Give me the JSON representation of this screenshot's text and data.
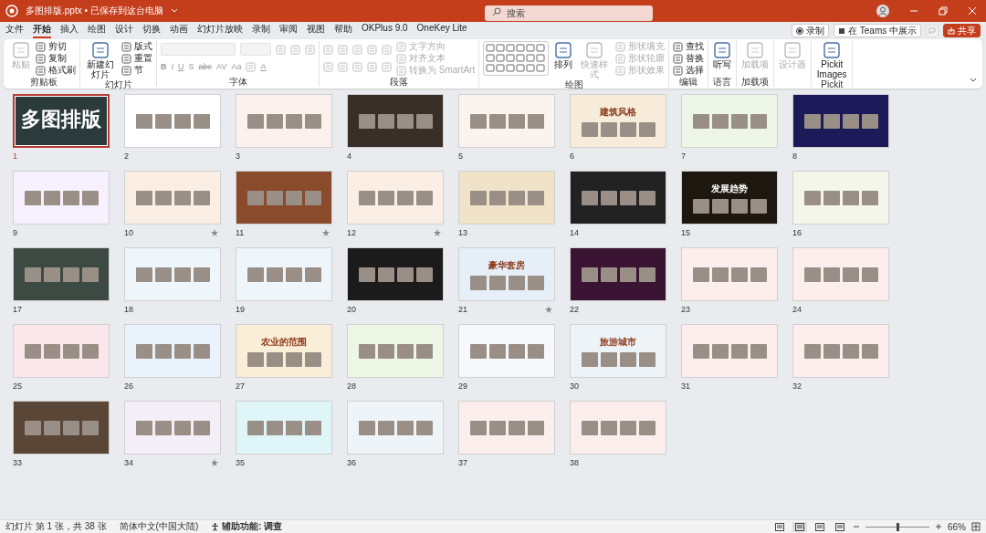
{
  "title_bar": {
    "document_title": "多图排版.pptx • 已保存到这台电脑",
    "search_placeholder": "搜索"
  },
  "menu_tabs": [
    {
      "label": "文件",
      "selected": false
    },
    {
      "label": "开始",
      "selected": true
    },
    {
      "label": "插入",
      "selected": false
    },
    {
      "label": "绘图",
      "selected": false
    },
    {
      "label": "设计",
      "selected": false
    },
    {
      "label": "切换",
      "selected": false
    },
    {
      "label": "动画",
      "selected": false
    },
    {
      "label": "幻灯片放映",
      "selected": false
    },
    {
      "label": "录制",
      "selected": false
    },
    {
      "label": "审阅",
      "selected": false
    },
    {
      "label": "视图",
      "selected": false
    },
    {
      "label": "帮助",
      "selected": false
    },
    {
      "label": "OKPlus 9.0",
      "selected": false
    },
    {
      "label": "OneKey Lite",
      "selected": false
    }
  ],
  "actions": {
    "record": "录制",
    "teams": "在 Teams 中展示",
    "share": "共享"
  },
  "ribbon_groups": [
    {
      "label": "剪贴板",
      "columns": [
        [
          {
            "kind": "large",
            "label": "粘贴",
            "disabled": true
          }
        ],
        [
          {
            "kind": "small",
            "label": "剪切",
            "disabled": false
          },
          {
            "kind": "small",
            "label": "复制",
            "disabled": false
          },
          {
            "kind": "small",
            "label": "格式刷",
            "disabled": false
          }
        ]
      ]
    },
    {
      "label": "幻灯片",
      "columns": [
        [
          {
            "kind": "large",
            "label": "新建幻灯片",
            "disabled": false
          }
        ],
        [
          {
            "kind": "small",
            "label": "版式",
            "disabled": false
          },
          {
            "kind": "small",
            "label": "重置",
            "disabled": false
          },
          {
            "kind": "small",
            "label": "节",
            "disabled": false
          }
        ]
      ]
    },
    {
      "label": "字体",
      "columns": [
        [
          {
            "kind": "row",
            "items": [
              {
                "kind": "combo",
                "disabled": true
              },
              {
                "kind": "combo_narrow",
                "disabled": true
              },
              {
                "kind": "icon",
                "disabled": true
              },
              {
                "kind": "icon",
                "disabled": true
              },
              {
                "kind": "icon",
                "disabled": true
              }
            ]
          },
          {
            "kind": "row",
            "items": [
              {
                "kind": "glyph",
                "label": "B",
                "disabled": true
              },
              {
                "kind": "glyph",
                "label": "I",
                "disabled": true
              },
              {
                "kind": "glyph",
                "label": "U",
                "disabled": true
              },
              {
                "kind": "glyph",
                "label": "S",
                "disabled": true
              },
              {
                "kind": "glyph",
                "label": "abc",
                "disabled": true
              },
              {
                "kind": "glyph",
                "label": "AV",
                "disabled": true
              },
              {
                "kind": "glyph",
                "label": "Aa",
                "disabled": true
              },
              {
                "kind": "icon",
                "disabled": true
              },
              {
                "kind": "glyph",
                "label": "A",
                "disabled": true
              }
            ]
          }
        ]
      ]
    },
    {
      "label": "段落",
      "columns": [
        [
          {
            "kind": "row",
            "items": [
              {
                "kind": "icon",
                "disabled": true
              },
              {
                "kind": "icon",
                "disabled": true
              },
              {
                "kind": "icon",
                "disabled": true
              },
              {
                "kind": "icon",
                "disabled": true
              },
              {
                "kind": "icon",
                "disabled": true
              }
            ]
          },
          {
            "kind": "row",
            "items": [
              {
                "kind": "icon",
                "disabled": true
              },
              {
                "kind": "icon",
                "disabled": true
              },
              {
                "kind": "icon",
                "disabled": true
              },
              {
                "kind": "icon",
                "disabled": true
              },
              {
                "kind": "icon",
                "disabled": true
              }
            ]
          }
        ],
        [
          {
            "kind": "small",
            "label": "文字方向",
            "disabled": true
          },
          {
            "kind": "small",
            "label": "对齐文本",
            "disabled": true
          },
          {
            "kind": "small",
            "label": "转换为 SmartArt",
            "disabled": true
          }
        ]
      ]
    },
    {
      "label": "绘图",
      "columns": [
        [
          {
            "kind": "gallery"
          }
        ],
        [
          {
            "kind": "large",
            "label": "排列",
            "disabled": false
          }
        ],
        [
          {
            "kind": "large",
            "label": "快速样式",
            "disabled": true
          }
        ],
        [
          {
            "kind": "small",
            "label": "形状填充",
            "disabled": true
          },
          {
            "kind": "small",
            "label": "形状轮廓",
            "disabled": true
          },
          {
            "kind": "small",
            "label": "形状效果",
            "disabled": true
          }
        ]
      ]
    },
    {
      "label": "编辑",
      "columns": [
        [
          {
            "kind": "small",
            "label": "查找",
            "disabled": false
          },
          {
            "kind": "small",
            "label": "替换",
            "disabled": false
          },
          {
            "kind": "small",
            "label": "选择",
            "disabled": false
          }
        ]
      ]
    },
    {
      "label": "语言",
      "columns": [
        [
          {
            "kind": "large",
            "label": "听写",
            "disabled": false
          }
        ]
      ]
    },
    {
      "label": "加载项",
      "columns": [
        [
          {
            "kind": "large",
            "label": "加载项",
            "disabled": true
          }
        ]
      ]
    },
    {
      "columns": [
        [
          {
            "kind": "large",
            "label": "设计器",
            "disabled": true
          }
        ]
      ]
    },
    {
      "label": "Pickit",
      "columns": [
        [
          {
            "kind": "large",
            "label": "Pickit Images",
            "disabled": false
          }
        ]
      ]
    }
  ],
  "slides": [
    {
      "number": "1",
      "title": "多图排版",
      "color": "#2b3a3a",
      "selected": true,
      "transition": false
    },
    {
      "number": "2",
      "color": "#ffffff",
      "selected": false,
      "transition": false
    },
    {
      "number": "3",
      "color": "#fdf1ee",
      "selected": false,
      "transition": false
    },
    {
      "number": "4",
      "color": "#3a2e28",
      "selected": false,
      "transition": false
    },
    {
      "number": "5",
      "color": "#fbf3ee",
      "selected": false,
      "transition": false
    },
    {
      "number": "6",
      "title": "建筑风格",
      "color": "#f7ecd9",
      "selected": false,
      "transition": false
    },
    {
      "number": "7",
      "color": "#eef6e8",
      "selected": false,
      "transition": false
    },
    {
      "number": "8",
      "color": "#1d1a5a",
      "selected": false,
      "transition": false
    },
    {
      "number": "9",
      "color": "#f6f0ff",
      "selected": false,
      "transition": false
    },
    {
      "number": "10",
      "color": "#fbeee4",
      "selected": false,
      "transition": true
    },
    {
      "number": "11",
      "color": "#8a4a2c",
      "selected": false,
      "transition": true
    },
    {
      "number": "12",
      "color": "#fbeee4",
      "selected": false,
      "transition": true
    },
    {
      "number": "13",
      "color": "#f1e3c8",
      "selected": false,
      "transition": false
    },
    {
      "number": "14",
      "color": "#222222",
      "selected": false,
      "transition": false
    },
    {
      "number": "15",
      "title": "发展趋势",
      "color": "#1e1710",
      "selected": false,
      "transition": false
    },
    {
      "number": "16",
      "color": "#f4f6ea",
      "selected": false,
      "transition": false
    },
    {
      "number": "17",
      "color": "#3d4a44",
      "selected": false,
      "transition": false
    },
    {
      "number": "18",
      "color": "#eef6fc",
      "selected": false,
      "transition": false
    },
    {
      "number": "19",
      "color": "#eef6fc",
      "selected": false,
      "transition": false
    },
    {
      "number": "20",
      "color": "#1b1b1b",
      "selected": false,
      "transition": false
    },
    {
      "number": "21",
      "title": "豪华套房",
      "color": "#e6eef8",
      "selected": false,
      "transition": true
    },
    {
      "number": "22",
      "color": "#3a1432",
      "selected": false,
      "transition": false
    },
    {
      "number": "23",
      "color": "#fdeeee",
      "selected": false,
      "transition": false
    },
    {
      "number": "24",
      "color": "#fdeeee",
      "selected": false,
      "transition": false
    },
    {
      "number": "25",
      "color": "#fbe6ec",
      "selected": false,
      "transition": false
    },
    {
      "number": "26",
      "color": "#eaf2fb",
      "selected": false,
      "transition": false
    },
    {
      "number": "27",
      "title": "农业的范围",
      "color": "#fbeed8",
      "selected": false,
      "transition": false
    },
    {
      "number": "28",
      "color": "#eef6e6",
      "selected": false,
      "transition": false
    },
    {
      "number": "29",
      "color": "#f6f8fb",
      "selected": false,
      "transition": false
    },
    {
      "number": "30",
      "title": "旅游城市",
      "color": "#eef3f8",
      "selected": false,
      "transition": false
    },
    {
      "number": "31",
      "color": "#fdeeee",
      "selected": false,
      "transition": false
    },
    {
      "number": "32",
      "color": "#fdeeee",
      "selected": false,
      "transition": false
    },
    {
      "number": "33",
      "color": "#5a4636",
      "selected": false,
      "transition": false
    },
    {
      "number": "34",
      "color": "#f3eef8",
      "selected": false,
      "transition": true
    },
    {
      "number": "35",
      "color": "#dff5f8",
      "selected": false,
      "transition": false
    },
    {
      "number": "36",
      "color": "#eef4f8",
      "selected": false,
      "transition": false
    },
    {
      "number": "37",
      "color": "#fdeeee",
      "selected": false,
      "transition": false
    },
    {
      "number": "38",
      "color": "#fdeeee",
      "selected": false,
      "transition": false
    }
  ],
  "status_bar": {
    "slide_info": "幻灯片 第 1 张，共 38 张",
    "language": "简体中文(中国大陆)",
    "accessibility": "辅助功能: 调查",
    "zoom": {
      "level": 0.5,
      "reading": "66%"
    }
  }
}
